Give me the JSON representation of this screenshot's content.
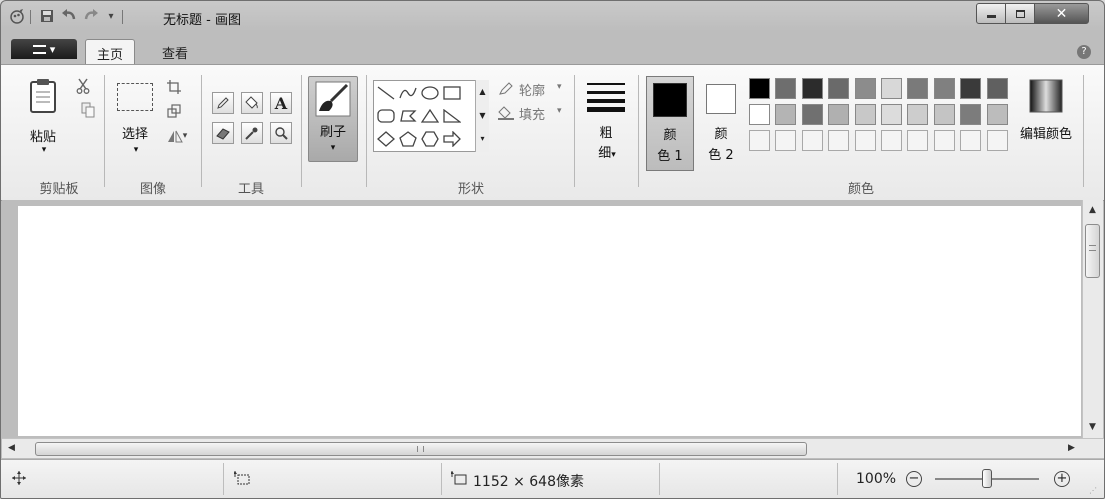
{
  "window": {
    "title": "无标题 - 画图"
  },
  "tabs": {
    "home": "主页",
    "view": "查看"
  },
  "clipboard": {
    "paste": "粘贴",
    "group": "剪贴板"
  },
  "image": {
    "select": "选择",
    "group": "图像"
  },
  "tools": {
    "group": "工具"
  },
  "brushes": {
    "label": "刷子"
  },
  "shapes": {
    "outline": "轮廓",
    "fill": "填充",
    "group": "形状"
  },
  "size": {
    "line1": "粗",
    "line2": "细"
  },
  "colors": {
    "color1_line1": "颜",
    "color1_line2": "色 1",
    "color2_line1": "颜",
    "color2_line2": "色 2",
    "edit": "编辑颜色",
    "group": "颜色",
    "color1_value": "#000000",
    "color2_value": "#ffffff",
    "palette_row1": [
      "#000000",
      "#6e6e6e",
      "#2c2c2c",
      "#6a6a6a",
      "#8c8c8c",
      "#d8d8d8",
      "#7a7a7a",
      "#808080",
      "#3a3a3a",
      "#606060"
    ],
    "palette_row2": [
      "#ffffff",
      "#b4b4b4",
      "#707070",
      "#b0b0b0",
      "#c8c8c8",
      "#dcdcdc",
      "#cdcdcd",
      "#c4c4c4",
      "#7c7c7c",
      "#bcbcbc"
    ],
    "palette_row3": [
      "#f4f4f4",
      "#f4f4f4",
      "#f4f4f4",
      "#f4f4f4",
      "#f4f4f4",
      "#f4f4f4",
      "#f4f4f4",
      "#f4f4f4",
      "#f4f4f4",
      "#f4f4f4"
    ]
  },
  "statusbar": {
    "canvas_size": "1152 × 648像素",
    "zoom": "100%"
  },
  "icons": {
    "app": "paint-app-icon",
    "save": "save-icon",
    "undo": "undo-icon",
    "redo": "redo-icon",
    "customize": "customize-arrow-icon",
    "help": "help-icon"
  }
}
